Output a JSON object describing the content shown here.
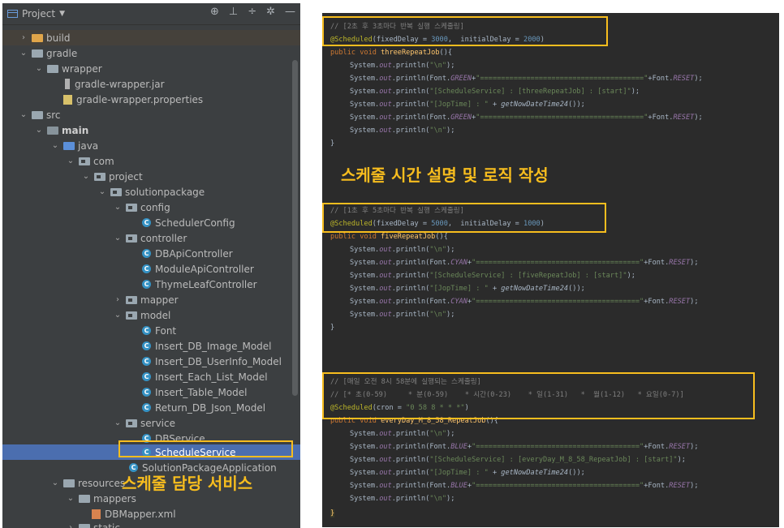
{
  "tree": {
    "title": "Project",
    "dropdown_glyph": "▼",
    "toolbar_icons": [
      "target-icon",
      "expand-all-icon",
      "collapse-all-icon",
      "gear-icon",
      "minimize-icon"
    ],
    "toolbar_glyphs": [
      "⊕",
      "⊥",
      "÷",
      "✲",
      "—"
    ],
    "expander_glyphs": {
      "expanded": "⌄",
      "collapsed": "›"
    },
    "class_glyph": "C",
    "items": [
      {
        "label": "build"
      },
      {
        "label": "gradle"
      },
      {
        "label": "wrapper"
      },
      {
        "label": "gradle-wrapper.jar"
      },
      {
        "label": "gradle-wrapper.properties"
      },
      {
        "label": "src"
      },
      {
        "label": "main"
      },
      {
        "label": "java"
      },
      {
        "label": "com"
      },
      {
        "label": "project"
      },
      {
        "label": "solutionpackage"
      },
      {
        "label": "config"
      },
      {
        "label": "SchedulerConfig"
      },
      {
        "label": "controller"
      },
      {
        "label": "DBApiController"
      },
      {
        "label": "ModuleApiController"
      },
      {
        "label": "ThymeLeafController"
      },
      {
        "label": "mapper"
      },
      {
        "label": "model"
      },
      {
        "label": "Font"
      },
      {
        "label": "Insert_DB_Image_Model"
      },
      {
        "label": "Insert_DB_UserInfo_Model"
      },
      {
        "label": "Insert_Each_List_Model"
      },
      {
        "label": "Insert_Table_Model"
      },
      {
        "label": "Return_DB_Json_Model"
      },
      {
        "label": "service"
      },
      {
        "label": "DBService"
      },
      {
        "label": "ScheduleService"
      },
      {
        "label": "SolutionPackageApplication"
      },
      {
        "label": "resources"
      },
      {
        "label": "mappers"
      },
      {
        "label": "DBMapper.xml"
      },
      {
        "label": "static"
      }
    ],
    "annotation": "스케줄 담당 서비스"
  },
  "code": {
    "annotation": "스케줄 시간 설명 및 로직 작성",
    "block1": {
      "comment": "// [2초 후 3초마다 반복 실행 스케줄링]",
      "anno": "@Scheduled",
      "args_a": "(fixedDelay = ",
      "val1": "3000",
      "args_b": ",  initialDelay = ",
      "val2": "2000",
      "args_c": ")",
      "decl_kw": "public void ",
      "method": "threeRepeatJob",
      "decl_end": "(){",
      "color": "GREEN",
      "label": "\"[ScheduleService] : [threeRepeatJob] : [start]\""
    },
    "block2": {
      "comment": "// [1초 후 5초마다 반복 실행 스케줄링]",
      "anno": "@Scheduled",
      "args_a": "(fixedDelay = ",
      "val1": "5000",
      "args_b": ",  initialDelay = ",
      "val2": "1000",
      "args_c": ")",
      "decl_kw": "public void ",
      "method": "fiveRepeatJob",
      "decl_end": "(){",
      "color": "CYAN",
      "label": "\"[ScheduleService] : [fiveRepeatJob] : [start]\""
    },
    "block3": {
      "comment1": "// [매일 오전 8시 58분에 실행되는 스케줄링]",
      "comment2": "// [* 초(0-59)     * 분(0-59)    * 시간(0-23)    * 일(1-31)   *  월(1-12)   * 요일(0-7)]",
      "anno": "@Scheduled",
      "args_a": "(cron = ",
      "cron": "\"0 58 8 * * *\"",
      "args_c": ")",
      "decl_kw": "public void ",
      "method": "everyDay_M_8_58_RepeatJob",
      "decl_end": "(){",
      "color": "BLUE",
      "label": "\"[ScheduleService] : [everyDay_M_8_58_RepeatJob] : [start]\""
    },
    "common": {
      "sys": "System.",
      "out": "out",
      "println": ".println(",
      "newline": "\"\\n\"",
      "end": ");",
      "font_open": "Font.",
      "plus": "+",
      "line_str": "\"=======================================\"",
      "reset_a": "+Font.",
      "reset": "RESET",
      "jop": "\"[JopTime] : \"",
      "plus_sp": " + ",
      "now": "getNowDateTime24",
      "now_end": "());",
      "close": "}"
    }
  }
}
